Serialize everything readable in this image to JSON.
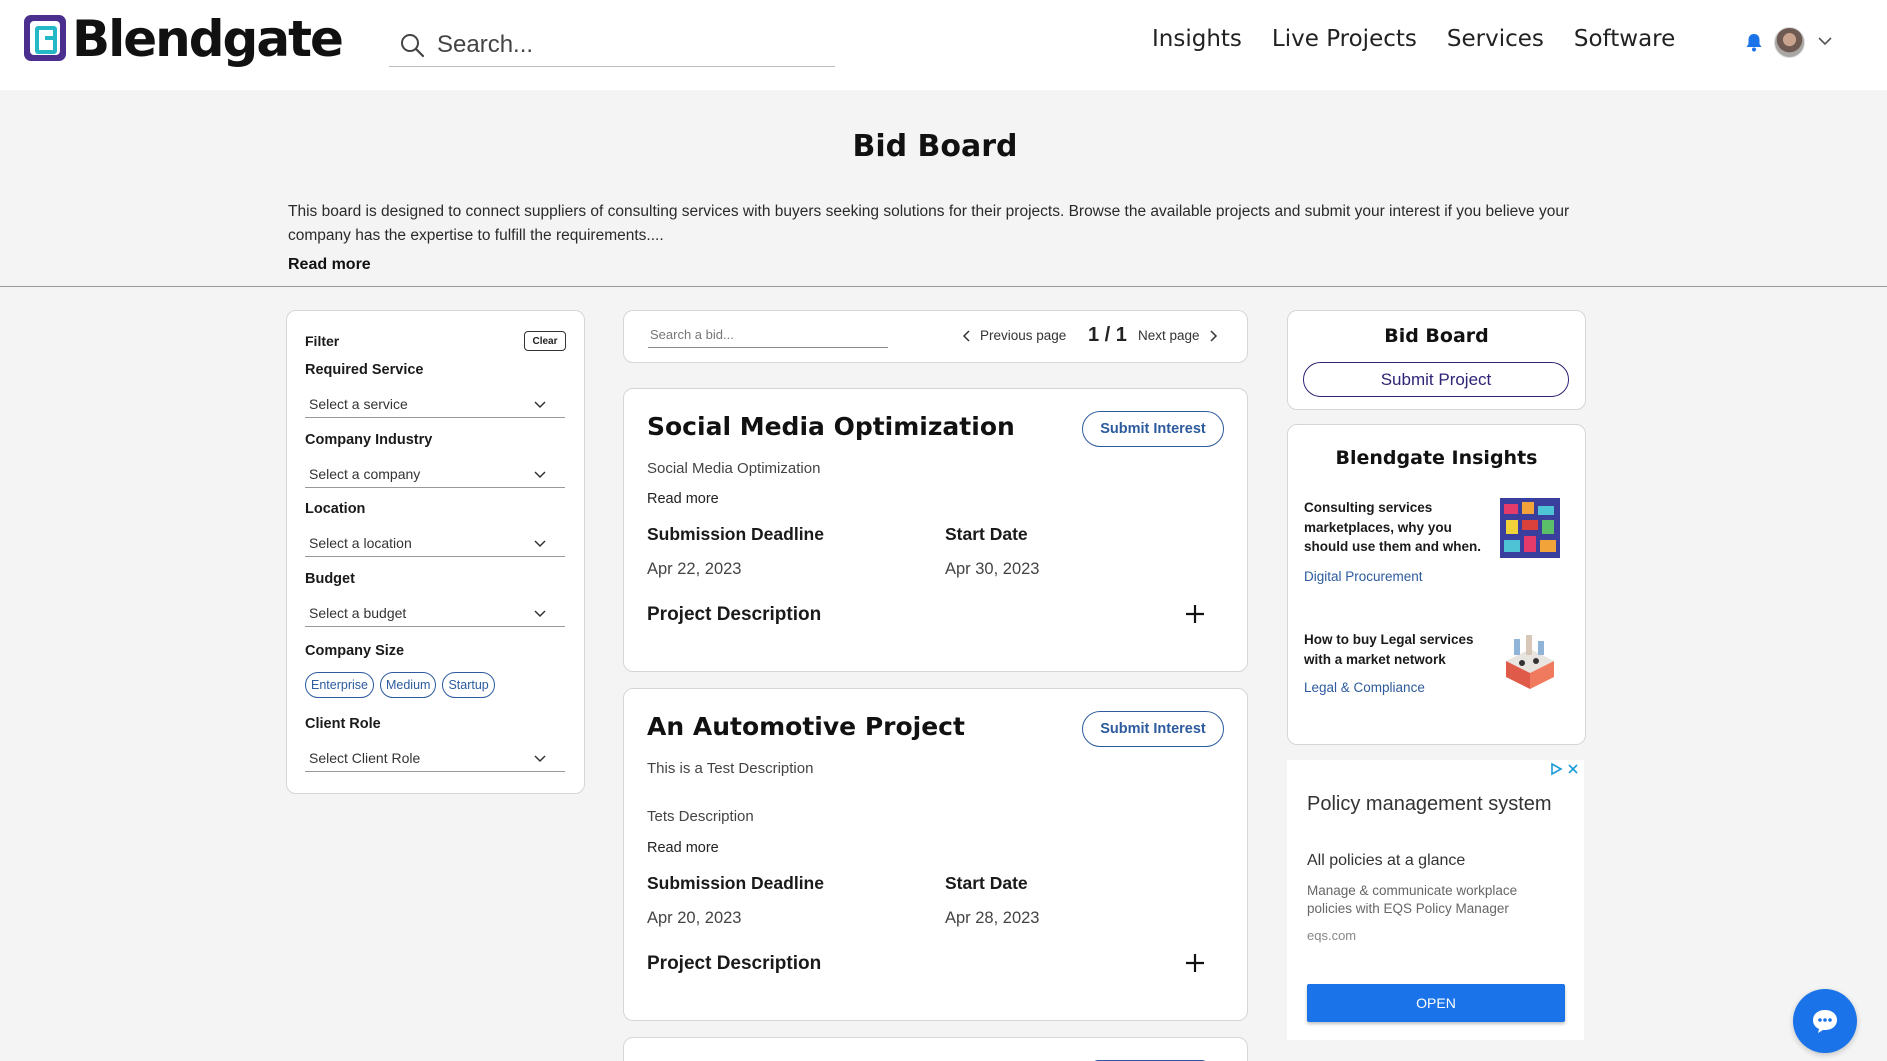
{
  "brand": {
    "name": "Blendgate"
  },
  "header": {
    "search_placeholder": "Search...",
    "nav": [
      "Insights",
      "Live Projects",
      "Services",
      "Software"
    ]
  },
  "intro": {
    "title": "Bid Board",
    "text": "This board is designed to connect suppliers of consulting services with buyers seeking solutions for their projects. Browse the available projects and submit your interest if you believe your company has the expertise to fulfill the requirements....",
    "read_more": "Read more"
  },
  "filter": {
    "title": "Filter",
    "clear": "Clear",
    "required_service": {
      "label": "Required Service",
      "value": "Select a service"
    },
    "company_industry": {
      "label": "Company Industry",
      "value": "Select a company"
    },
    "location": {
      "label": "Location",
      "value": "Select a location"
    },
    "budget": {
      "label": "Budget",
      "value": "Select a budget"
    },
    "company_size": {
      "label": "Company Size",
      "options": [
        "Enterprise",
        "Medium",
        "Startup"
      ]
    },
    "client_role": {
      "label": "Client Role",
      "value": "Select Client Role"
    }
  },
  "bids": {
    "search_placeholder": "Search a bid...",
    "prev": "Previous page",
    "page": "1 / 1",
    "next": "Next page",
    "projects": [
      {
        "title": "Social Media Optimization",
        "subtitle": "Social Media Optimization",
        "extra": "",
        "read_more": "Read more",
        "submit": "Submit Interest",
        "deadline_label": "Submission Deadline",
        "deadline": "Apr 22, 2023",
        "start_label": "Start Date",
        "start": "Apr 30, 2023",
        "desc_label": "Project Description"
      },
      {
        "title": "An Automotive Project",
        "subtitle": "This is a Test Description",
        "extra": "Tets Description",
        "read_more": "Read more",
        "submit": "Submit Interest",
        "deadline_label": "Submission Deadline",
        "deadline": "Apr 20, 2023",
        "start_label": "Start Date",
        "start": "Apr 28, 2023",
        "desc_label": "Project Description"
      }
    ]
  },
  "sidebar": {
    "board_title": "Bid Board",
    "submit_project": "Submit Project",
    "insights_title": "Blendgate Insights",
    "insights": [
      {
        "title": "Consulting services marketplaces, why you should use them and when.",
        "tag": "Digital Procurement"
      },
      {
        "title": "How to buy Legal services with a market network",
        "tag": "Legal & Compliance"
      }
    ]
  },
  "ad": {
    "title": "Policy management system",
    "subtitle": "All policies at a glance",
    "desc": "Manage & communicate workplace policies with EQS Policy Manager",
    "domain": "eqs.com",
    "cta": "OPEN"
  },
  "colors": {
    "accent": "#2d5b9e",
    "brand": "#2e2475",
    "ad_button": "#1a73e8"
  },
  "icons": [
    "search-icon",
    "bell-icon",
    "avatar",
    "chevron-down-icon",
    "chevron-left-icon",
    "chevron-right-icon",
    "plus-icon",
    "ad-choices-icon",
    "close-icon",
    "chat-icon"
  ]
}
